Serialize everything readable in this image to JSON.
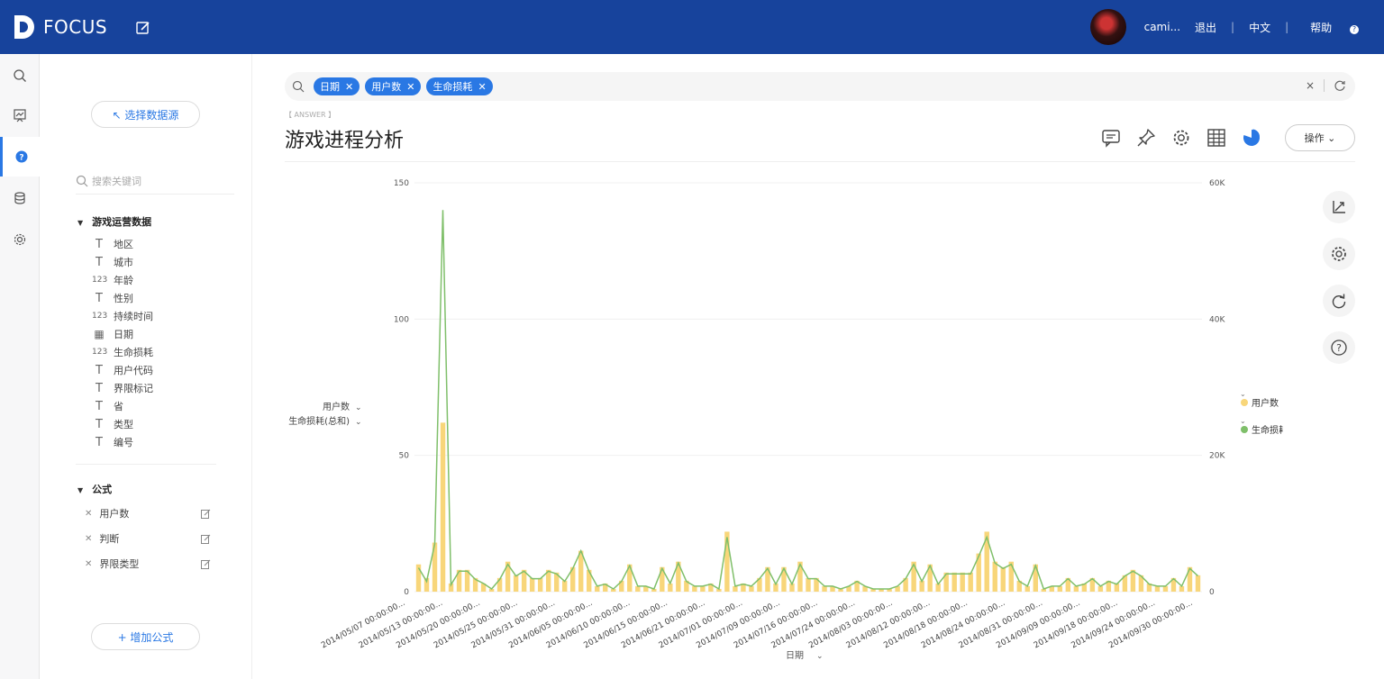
{
  "topbar": {
    "brand": "FOCUS",
    "user_name": "cami...",
    "logout": "退出",
    "lang": "中文",
    "help": "帮助",
    "sep": "|"
  },
  "panel": {
    "choose_source": "↖ 选择数据源",
    "search_placeholder": "搜索关键词",
    "group1": {
      "title": "游戏运营数据",
      "fields": [
        {
          "type": "T",
          "label": "地区"
        },
        {
          "type": "T",
          "label": "城市"
        },
        {
          "type": "123",
          "label": "年龄"
        },
        {
          "type": "T",
          "label": "性别"
        },
        {
          "type": "123",
          "label": "持续时间"
        },
        {
          "type": "cal",
          "label": "日期"
        },
        {
          "type": "123",
          "label": "生命损耗"
        },
        {
          "type": "T",
          "label": "用户代码"
        },
        {
          "type": "T",
          "label": "界限标记"
        },
        {
          "type": "T",
          "label": "省"
        },
        {
          "type": "T",
          "label": "类型"
        },
        {
          "type": "T",
          "label": "编号"
        }
      ]
    },
    "group2": {
      "title": "公式",
      "items": [
        "用户数",
        "判断",
        "界限类型"
      ]
    },
    "add_formula": "+ 增加公式"
  },
  "search": {
    "tags": [
      "日期",
      "用户数",
      "生命损耗"
    ],
    "clear": "×"
  },
  "answer_label": "【 ANSWER 】",
  "title": "游戏进程分析",
  "ops_label": "操作",
  "colors": {
    "topbar": "#17439c",
    "accent": "#2a78e4",
    "bar": "#f8d67a",
    "line": "#7fbf6a"
  },
  "chart_data": {
    "type": "bar+line",
    "xlabel": "日期",
    "y_left_ticks": [
      "150",
      "100",
      "50",
      "0"
    ],
    "y_right_ticks": [
      "60K",
      "40K",
      "20K",
      "0"
    ],
    "y_left_range": [
      0,
      150
    ],
    "y_right_range": [
      0,
      60000
    ],
    "left_axis_labels": [
      "用户数",
      "生命损耗(总和)"
    ],
    "legend": [
      "用户数",
      "生命损耗的总和"
    ],
    "x_tick_labels": [
      "2014/05/07 00:00:00...",
      "2014/05/13 00:00:00...",
      "2014/05/20 00:00:00...",
      "2014/05/25 00:00:00...",
      "2014/05/31 00:00:00...",
      "2014/06/05 00:00:00...",
      "2014/06/10 00:00:00...",
      "2014/06/15 00:00:00...",
      "2014/06/21 00:00:00...",
      "2014/07/01 00:00:00...",
      "2014/07/09 00:00:00...",
      "2014/07/16 00:00:00...",
      "2014/07/24 00:00:00...",
      "2014/08/03 00:00:00...",
      "2014/08/12 00:00:00...",
      "2014/08/18 00:00:00...",
      "2014/08/24 00:00:00...",
      "2014/08/31 00:00:00...",
      "2014/09/09 00:00:00...",
      "2014/09/18 00:00:00...",
      "2014/09/24 00:00:00...",
      "2014/09/30 00:00:00..."
    ],
    "series": [
      {
        "name": "用户数",
        "type": "bar",
        "values": [
          10,
          5,
          18,
          62,
          3,
          8,
          8,
          5,
          3,
          1,
          5,
          11,
          6,
          8,
          5,
          5,
          8,
          7,
          4,
          9,
          15,
          8,
          2,
          3,
          1,
          4,
          10,
          2,
          2,
          1,
          9,
          3,
          11,
          4,
          2,
          2,
          3,
          1,
          22,
          2,
          3,
          2,
          5,
          9,
          3,
          9,
          3,
          11,
          5,
          5,
          2,
          2,
          1,
          2,
          4,
          2,
          1,
          1,
          1,
          2,
          5,
          11,
          4,
          10,
          3,
          7,
          7,
          7,
          7,
          14,
          22,
          11,
          9,
          11,
          4,
          2,
          10,
          1,
          2,
          2,
          5,
          2,
          3,
          5,
          2,
          4,
          3,
          6,
          8,
          6,
          3,
          2,
          2,
          5,
          2,
          9,
          6
        ],
        "line_values": [
          3500,
          1500,
          7000,
          56000,
          1000,
          3000,
          3000,
          1800,
          1200,
          400,
          1800,
          4000,
          2300,
          3000,
          1900,
          1900,
          3000,
          2600,
          1500,
          3400,
          6000,
          3000,
          800,
          1100,
          400,
          1500,
          3800,
          800,
          800,
          400,
          3400,
          1200,
          4200,
          1500,
          800,
          800,
          1100,
          400,
          8000,
          800,
          1100,
          800,
          1900,
          3400,
          1100,
          3400,
          1100,
          4000,
          1900,
          1900,
          800,
          800,
          400,
          800,
          1500,
          800,
          400,
          400,
          400,
          800,
          1900,
          4000,
          1500,
          3800,
          1100,
          2600,
          2600,
          2600,
          2600,
          5200,
          8000,
          4200,
          3400,
          4000,
          1500,
          800,
          3800,
          400,
          800,
          800,
          1900,
          800,
          1100,
          1900,
          800,
          1500,
          1100,
          2300,
          3000,
          2300,
          1100,
          800,
          800,
          1900,
          800,
          3400,
          2300
        ]
      }
    ]
  }
}
